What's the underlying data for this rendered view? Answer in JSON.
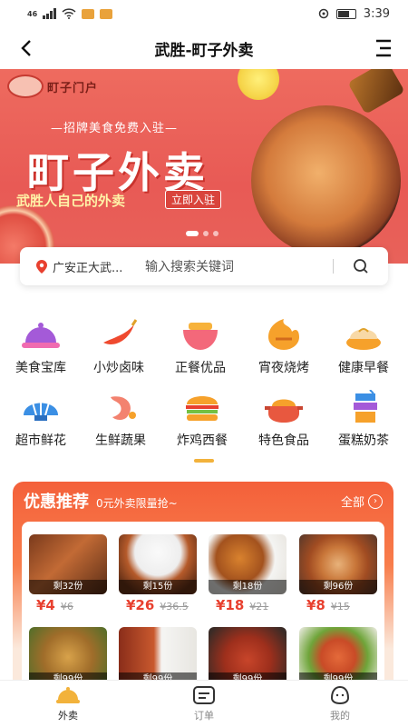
{
  "status_bar": {
    "network": "46",
    "time": "3:39"
  },
  "nav": {
    "title": "武胜-町子外卖"
  },
  "banner": {
    "logo_text": "町子门户",
    "slogan": "—招牌美食免费入驻—",
    "headline": "町子外卖",
    "tagline": "武胜人自己的外卖",
    "join_label": "立即入驻"
  },
  "search": {
    "location": "广安正大武...",
    "placeholder": "输入搜索关键词"
  },
  "categories": [
    {
      "label": "美食宝库",
      "icon": "cloche-icon"
    },
    {
      "label": "小炒卤味",
      "icon": "chili-icon"
    },
    {
      "label": "正餐优品",
      "icon": "bowl-icon"
    },
    {
      "label": "宵夜烧烤",
      "icon": "bbq-icon"
    },
    {
      "label": "健康早餐",
      "icon": "dumpling-icon"
    },
    {
      "label": "超市鲜花",
      "icon": "shell-icon"
    },
    {
      "label": "生鲜蔬果",
      "icon": "shrimp-icon"
    },
    {
      "label": "炸鸡西餐",
      "icon": "burger-icon"
    },
    {
      "label": "特色食品",
      "icon": "pot-icon"
    },
    {
      "label": "蛋糕奶茶",
      "icon": "drink-icon"
    }
  ],
  "promo": {
    "title": "优惠推荐",
    "subtitle": "0元外卖限量抢~",
    "all_label": "全部",
    "items": [
      {
        "stock": "剩32份",
        "price": "¥4",
        "old_price": "¥6"
      },
      {
        "stock": "剩15份",
        "price": "¥26",
        "old_price": "¥36.5"
      },
      {
        "stock": "剩18份",
        "price": "¥18",
        "old_price": "¥21"
      },
      {
        "stock": "剩96份",
        "price": "¥8",
        "old_price": "¥15"
      },
      {
        "stock": "剩99份",
        "price": "",
        "old_price": ""
      },
      {
        "stock": "剩99份",
        "price": "",
        "old_price": ""
      },
      {
        "stock": "剩99份",
        "price": "",
        "old_price": ""
      },
      {
        "stock": "剩99份",
        "price": "",
        "old_price": ""
      }
    ]
  },
  "tabbar": [
    {
      "label": "外卖",
      "icon": "cloche-icon",
      "active": true
    },
    {
      "label": "订单",
      "icon": "order-icon",
      "active": false
    },
    {
      "label": "我的",
      "icon": "profile-icon",
      "active": false
    }
  ],
  "colors": {
    "accent": "#f2b23b",
    "banner_red": "#e85a55",
    "price_red": "#e8402f",
    "promo_orange": "#f4603a"
  }
}
